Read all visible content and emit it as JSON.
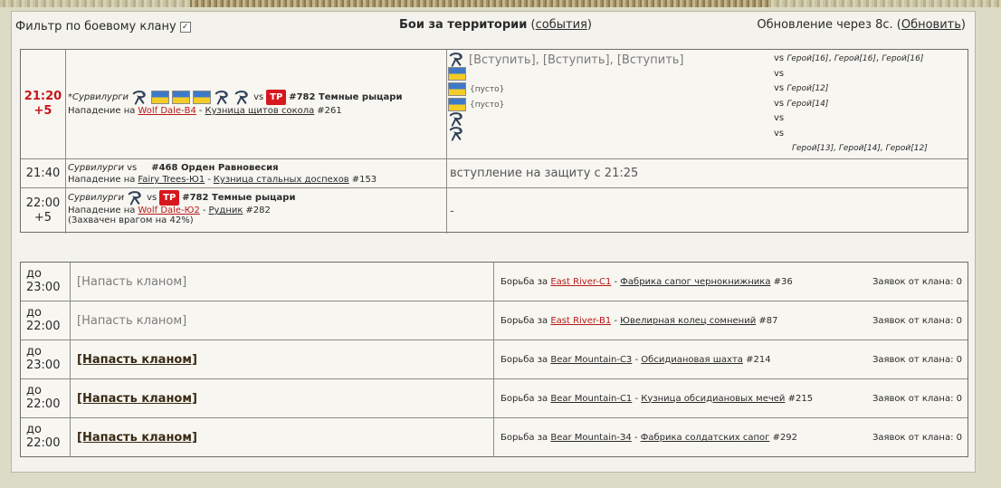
{
  "header": {
    "filter_label": "Фильтр по боевому клану",
    "filter_checked": "✓",
    "title": "Бои за территории",
    "events_link": "события",
    "update_text": "Обновление через 8с.",
    "refresh_link": "Обновить"
  },
  "battles": [
    {
      "time": "21:20",
      "time_sub": "+5",
      "attacker": "*Сурвилурги",
      "vs": "vs",
      "defender": "#782 Темные рыцари",
      "attack_prefix": "Нападение на",
      "territory": "Wolf Dale-В4",
      "sep": "-",
      "building": "Кузница щитов сокола",
      "building_num": "#261",
      "join_line": "[Вступить], [Вступить], [Вступить]",
      "empty1": "{пусто}",
      "empty2": "{пусто}",
      "vs_rows": [
        {
          "vs": "vs",
          "heroes": [
            "Герой[16]",
            "Герой[16]",
            "Герой[16]"
          ]
        },
        {
          "vs": "vs",
          "heroes": []
        },
        {
          "vs": "vs",
          "heroes": [
            "Герой[12]"
          ]
        },
        {
          "vs": "vs",
          "heroes": [
            "Герой[14]"
          ]
        },
        {
          "vs": "vs",
          "heroes": []
        },
        {
          "vs": "vs",
          "heroes": []
        }
      ],
      "bottom_heroes": "Герой[13], Герой[14], Герой[12]"
    },
    {
      "time": "21:40",
      "attacker": "Сурвилурги",
      "vs": "vs",
      "defender": "#468 Орден Равновесия",
      "attack_prefix": "Нападение на",
      "territory": "Fairy Trees-Ю1",
      "sep": "-",
      "building": "Кузница стальных доспехов",
      "building_num": "#153",
      "right_text": "вступление на защиту с 21:25"
    },
    {
      "time": "22:00",
      "time_sub": "+5",
      "attacker": "Сурвилурги",
      "vs": "vs",
      "defender": "#782 Темные рыцари",
      "attack_prefix": "Нападение на",
      "territory": "Wolf Dale-Ю2",
      "sep": "-",
      "building": "Рудник",
      "building_num": "#282",
      "captured": "(Захвачен врагом на 42%)",
      "right_text": "-"
    }
  ],
  "attacks": [
    {
      "until": "до",
      "time": "23:00",
      "button": "[Напасть кланом]",
      "state": "disabled",
      "prefix": "Борьба за",
      "territory": "East River-С1",
      "sep": "-",
      "building": "Фабрика сапог чернокнижника",
      "num": "#36",
      "requests": "Заявок от клана: 0"
    },
    {
      "until": "до",
      "time": "22:00",
      "button": "[Напасть кланом]",
      "state": "disabled",
      "prefix": "Борьба за",
      "territory": "East River-В1",
      "sep": "-",
      "building": "Ювелирная колец сомнений",
      "num": "#87",
      "requests": "Заявок от клана: 0"
    },
    {
      "until": "до",
      "time": "23:00",
      "button": "[Напасть кланом]",
      "state": "active",
      "prefix": "Борьба за",
      "territory": "Bear Mountain-С3",
      "sep": "-",
      "building": "Обсидиановая шахта",
      "num": "#214",
      "requests": "Заявок от клана: 0"
    },
    {
      "until": "до",
      "time": "22:00",
      "button": "[Напасть кланом]",
      "state": "active",
      "prefix": "Борьба за",
      "territory": "Bear Mountain-С1",
      "sep": "-",
      "building": "Кузница обсидиановых мечей",
      "num": "#215",
      "requests": "Заявок от клана: 0"
    },
    {
      "until": "до",
      "time": "22:00",
      "button": "[Напасть кланом]",
      "state": "active",
      "prefix": "Борьба за",
      "territory": "Bear Mountain-З4",
      "sep": "-",
      "building": "Фабрика солдатских сапог",
      "num": "#292",
      "requests": "Заявок от клана: 0"
    }
  ],
  "icons": {
    "clan_emblem": "bird-emblem-icon",
    "clan_flag": "blue-yellow-flag-icon",
    "enemy_emblem": "tp-emblem-icon"
  },
  "colors": {
    "time_highlight": "#c8141a",
    "territory_link": "#b81a1a",
    "flag_blue": "#3e79c9",
    "flag_yellow": "#f3cc27",
    "tp_red": "#d6171d"
  }
}
